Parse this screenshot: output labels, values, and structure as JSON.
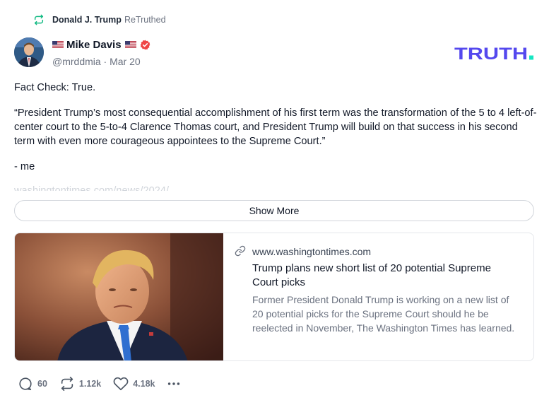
{
  "retruth_banner": {
    "user": "Donald J. Trump",
    "label": "ReTruthed",
    "icon": "retruth-icon"
  },
  "author": {
    "name": "Mike Davis",
    "handle_line": "@mrddmia · Mar 20",
    "flag": "us-flag-emoji",
    "verified_icon": "verified-badge-icon"
  },
  "brand": {
    "logo_text": "TRUTH.",
    "color_primary": "#5448ee",
    "color_accent": "#17e6c2"
  },
  "post": {
    "paragraphs": [
      "Fact Check: True.",
      "“President Trump’s most consequential accomplishment of his first term was the transformation of the 5 to 4 left-of-center court to the 5-to-4 Clarence Thomas court, and President Trump will build on that success in his second term with even more courageous appointees to the Supreme Court.”",
      "- me"
    ],
    "faded_line": "washingtontimes.com/news/2024/..."
  },
  "show_more_label": "Show More",
  "link_card": {
    "domain": "www.washingtontimes.com",
    "title": "Trump plans new short list of 20 potential Supreme Court picks",
    "description": "Former President Donald Trump is working on a new list of 20 potential picks for the Supreme Court should he be reelected in November, The Washington Times has learned.",
    "icon": "link-icon"
  },
  "actions": {
    "replies": "60",
    "retruths": "1.12k",
    "likes": "4.18k",
    "more_icon": "more-horizontal-icon"
  }
}
